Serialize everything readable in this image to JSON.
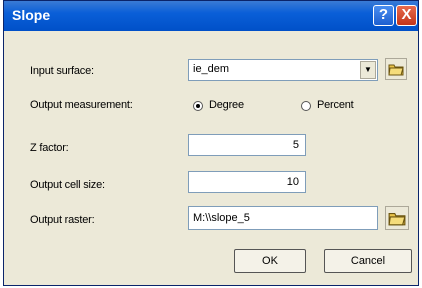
{
  "window": {
    "title": "Slope",
    "help_glyph": "?",
    "close_glyph": "X"
  },
  "form": {
    "input_surface": {
      "label": "Input surface:",
      "value": "ie_dem"
    },
    "output_measurement": {
      "label": "Output measurement:",
      "options": [
        "Degree",
        "Percent"
      ],
      "selected": "Degree"
    },
    "z_factor": {
      "label": "Z factor:",
      "value": "5"
    },
    "cell_size": {
      "label": "Output cell size:",
      "value": "10"
    },
    "output_raster": {
      "label": "Output raster:",
      "value": "M:\\\\slope_5"
    }
  },
  "buttons": {
    "ok": "OK",
    "cancel": "Cancel"
  },
  "icons": {
    "dropdown": "chevron-down-icon",
    "browse": "folder-icon"
  }
}
